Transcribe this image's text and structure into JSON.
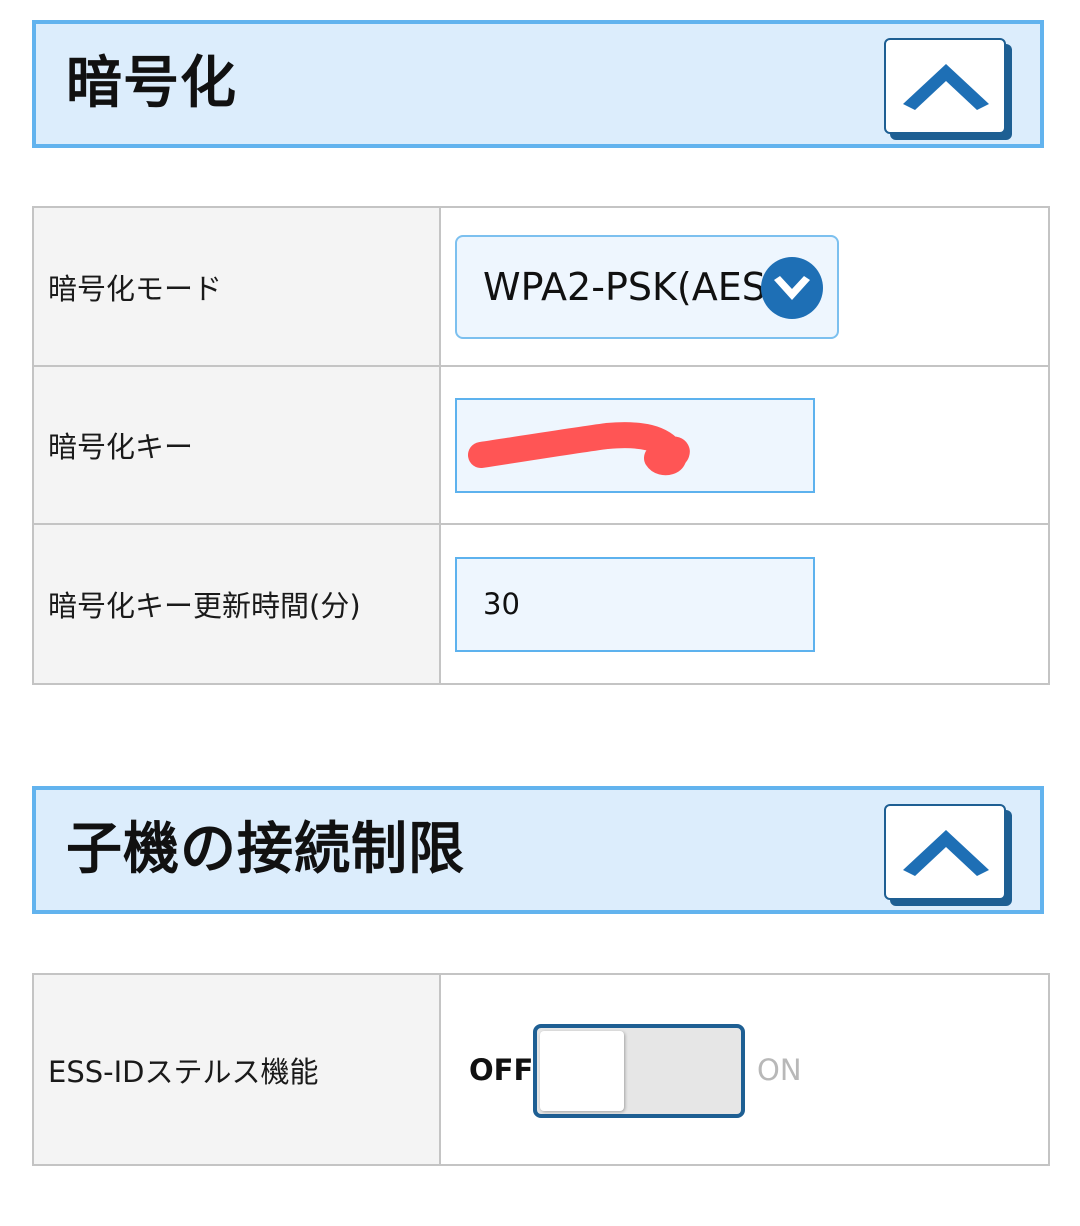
{
  "encryption": {
    "title": "暗号化",
    "collapse_icon": "chevron-up-icon",
    "mode_label": "暗号化モード",
    "mode_value": "WPA2-PSK(AES)",
    "mode_dropdown_icon": "chevron-down-icon",
    "key_label": "暗号化キー",
    "key_value": "",
    "key_redaction_color": "#ff5555",
    "rekey_label": "暗号化キー更新時間(分)",
    "rekey_value": "30"
  },
  "client_restriction": {
    "title": "子機の接続制限",
    "collapse_icon": "chevron-up-icon",
    "stealth_label": "ESS-IDステルス機能",
    "toggle_off_label": "OFF",
    "toggle_on_label": "ON",
    "stealth_enabled": false
  },
  "colors": {
    "header_bg": "#dcedfc",
    "header_border": "#62b3ee",
    "accent": "#1e6fb5",
    "button_shadow": "#1e5f93"
  }
}
